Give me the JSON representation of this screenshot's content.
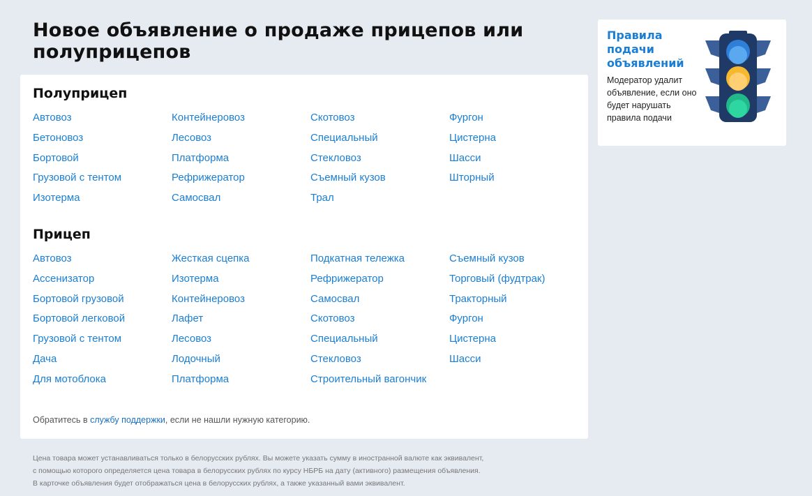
{
  "page_title": "Новое объявление о продаже прицепов или полуприцепов",
  "semitrailer": {
    "title": "Полуприцеп",
    "links": [
      "Автовоз",
      "Бетоновоз",
      "Бортовой",
      "Грузовой с тентом",
      "Изотерма",
      "Контейнеровоз",
      "Лесовоз",
      "Платформа",
      "Рефрижератор",
      "Самосвал",
      "Скотовоз",
      "Специальный",
      "Стекловоз",
      "Съемный кузов",
      "Трал",
      "Фургон",
      "Цистерна",
      "Шасси",
      "Шторный"
    ]
  },
  "trailer": {
    "title": "Прицеп",
    "links": [
      "Автовоз",
      "Ассенизатор",
      "Бортовой грузовой",
      "Бортовой легковой",
      "Грузовой с тентом",
      "Дача",
      "Для мотоблока",
      "Жесткая сцепка",
      "Изотерма",
      "Контейнеровоз",
      "Лафет",
      "Лесовоз",
      "Лодочный",
      "Платформа",
      "Подкатная тележка",
      "Рефрижератор",
      "Самосвал",
      "Скотовоз",
      "Специальный",
      "Стекловоз",
      "Строительный вагончик",
      "Съемный кузов",
      "Торговый (фудтрак)",
      "Тракторный",
      "Фургон",
      "Цистерна",
      "Шасси"
    ]
  },
  "support": {
    "before": "Обратитесь в ",
    "link": "службу поддержки",
    "after": ", если не нашли нужную категорию."
  },
  "sidebar": {
    "title": "Правила подачи объявлений",
    "text": "Модератор удалит объявление, если оно будет нарушать правила подачи",
    "icon": "traffic-light-icon"
  },
  "footer": {
    "line1": "Цена товара может устанавливаться только в белорусских рублях. Вы можете указать сумму в иностранной валюте как эквивалент,",
    "line2": "с помощью которого определяется цена товара в белорусских рублях по курсу НБРБ на дату (активного) размещения объявления.",
    "line3": "В карточке объявления будет отображаться цена в белорусских рублях, а также указанный вами эквивалент."
  },
  "colors": {
    "background": "#e6ebf2",
    "link": "#1a7fd4",
    "light_red_slot": "#5aa8f0",
    "light_yellow": "#f5b82e",
    "light_green": "#2ed6a0",
    "light_body": "#1f3a66"
  }
}
